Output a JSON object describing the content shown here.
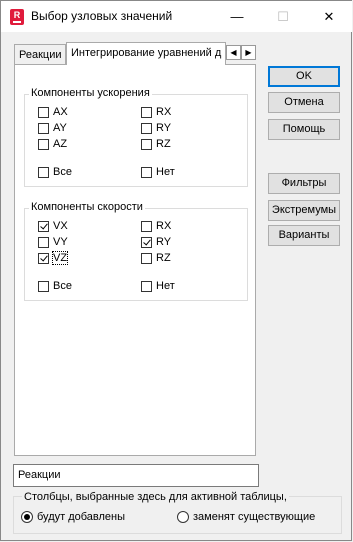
{
  "window": {
    "title": "Выбор узловых значений",
    "app_icon_letter": "R"
  },
  "titlebar": {
    "minimize": "—",
    "maximize": "☐",
    "close": "✕"
  },
  "tabs": [
    {
      "label": "Реакции"
    },
    {
      "label": "Интегрирование уравнений д"
    }
  ],
  "tab_scroll": {
    "left": "◀",
    "right": "▶"
  },
  "acceleration": {
    "title": "Компоненты ускорения",
    "ax": "AX",
    "ay": "AY",
    "az": "AZ",
    "rx": "RX",
    "ry": "RY",
    "rz": "RZ",
    "all": "Все",
    "none": "Нет"
  },
  "velocity": {
    "title": "Компоненты скорости",
    "vx": "VX",
    "vy": "VY",
    "vz": "VZ",
    "rx": "RX",
    "ry": "RY",
    "rz": "RZ",
    "all": "Все",
    "none": "Нет"
  },
  "buttons": {
    "ok": "OK",
    "cancel": "Отмена",
    "help": "Помощь",
    "filters": "Фильтры",
    "extremes": "Экстремумы",
    "variants": "Варианты"
  },
  "table_name": {
    "value": "Реакции"
  },
  "mode": {
    "label": "Столбцы, выбранные здесь для активной таблицы,",
    "add": "будут добавлены",
    "replace": "заменят существующие"
  }
}
